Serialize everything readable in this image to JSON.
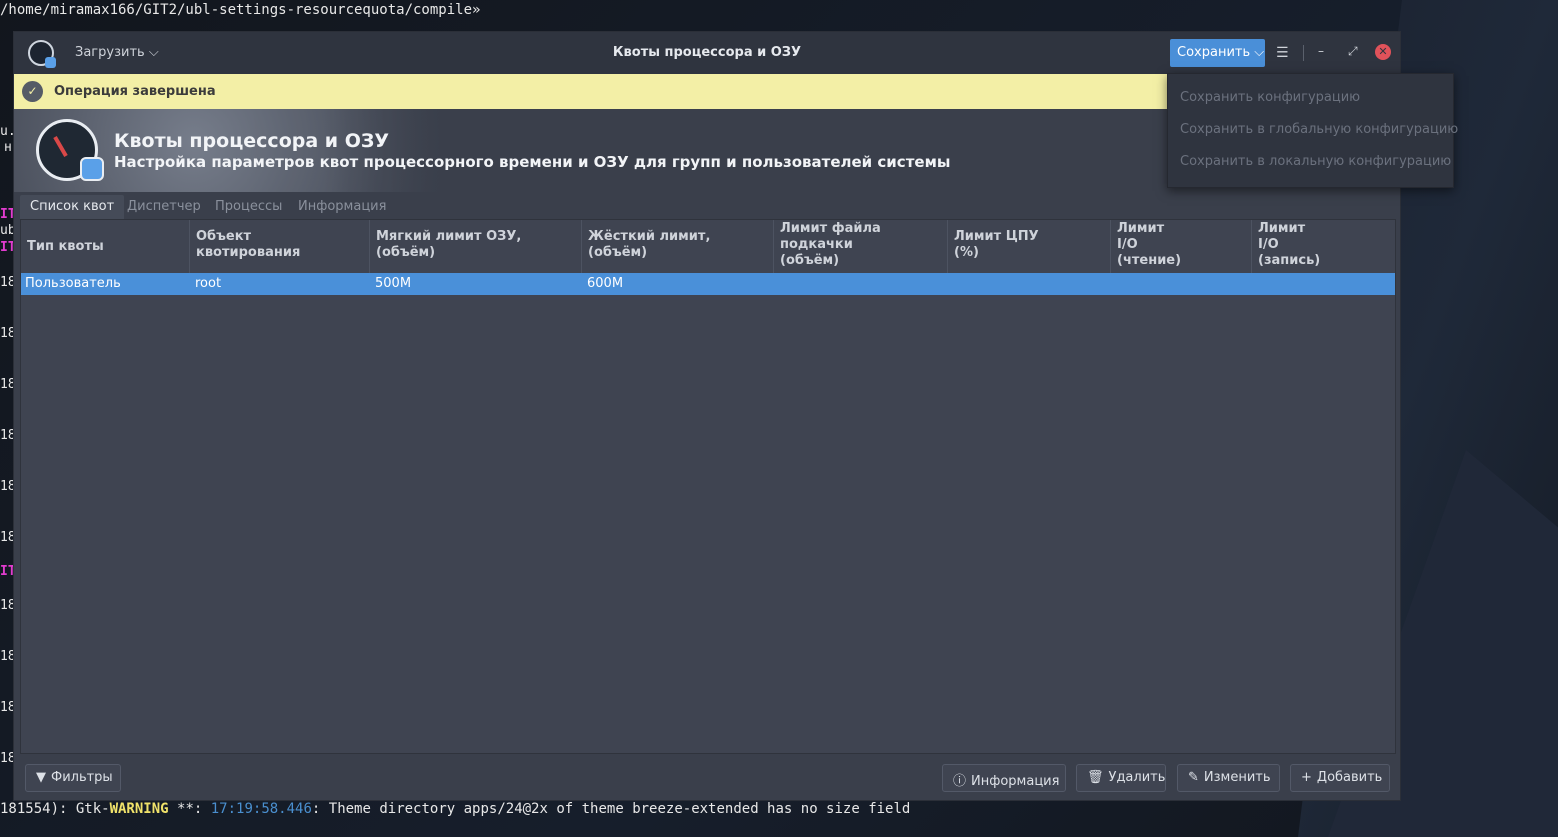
{
  "terminal": {
    "top_line": "/home/miramax166/GIT2/ubl-settings-resourcequota/compile»",
    "bottom_prefix": "181554): Gtk-",
    "bottom_warn": "WARNING",
    "bottom_mid": " **: ",
    "bottom_time": "17:19:58.446",
    "bottom_rest": ": Theme directory apps/24@2x of theme breeze-extended has no size field",
    "side_fragments": [
      "u.",
      "н",
      "IT",
      "ub",
      "IT",
      "18",
      "18",
      "18",
      "18",
      "18",
      "18",
      "IT",
      "18",
      "18",
      "18",
      "18"
    ]
  },
  "window": {
    "title": "Квоты процессора и ОЗУ",
    "load_label": "Загрузить",
    "save_label": "Сохранить",
    "menu_glyph": "☰",
    "min_glyph": "–",
    "max_glyph": "⤢",
    "close_glyph": "✕"
  },
  "infobar": {
    "check_glyph": "✓",
    "message": "Операция завершена"
  },
  "banner": {
    "title": "Квоты процессора и ОЗУ",
    "subtitle": "Настройка параметров квот процессорного времени и ОЗУ для групп и пользователей системы"
  },
  "tabs": [
    "Список квот",
    "Диспетчер",
    "Процессы",
    "Информация"
  ],
  "table": {
    "headers": [
      "Тип квоты",
      "Объект\nквотирования",
      "Мягкий лимит ОЗУ,\n(объём)",
      "Жёсткий лимит,\n(объём)",
      "Лимит файла\nподкачки\n(объём)",
      "Лимит ЦПУ\n(%)",
      "Лимит\nI/O\n(чтение)",
      "Лимит\nI/O\n(запись)"
    ],
    "rows": [
      {
        "type": "Пользователь",
        "object": "root",
        "soft": "500M",
        "hard": "600M",
        "swap": "",
        "cpu": "",
        "io_read": "",
        "io_write": ""
      }
    ]
  },
  "bottom": {
    "filters": "Фильтры",
    "info": "Информация",
    "delete": "Удалить",
    "edit": "Изменить",
    "add": "Добавить"
  },
  "dropdown": {
    "items": [
      "Сохранить конфигурацию",
      "Сохранить в глобальную конфигурацию",
      "Сохранить в локальную конфигурацию"
    ]
  },
  "colors": {
    "accent": "#4a8fd8",
    "selected_row": "#4a90d9",
    "infobar": "#f3efa6",
    "window_bg": "#3a3f4b"
  }
}
